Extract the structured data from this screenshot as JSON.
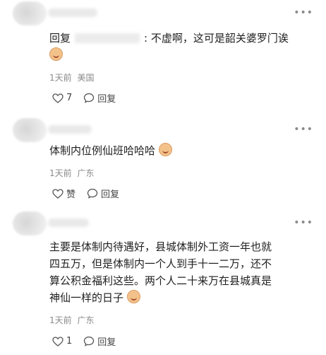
{
  "comments": [
    {
      "text_prefix": "回复",
      "text": ": 不虚啊，这可是韶关婆罗门诶",
      "time": "1天前",
      "location": "美国",
      "like_count": "7",
      "reply_label": "回复"
    },
    {
      "text": "体制内位例仙班哈哈哈",
      "time": "1天前",
      "location": "广东",
      "like_label": "赞",
      "reply_label": "回复"
    },
    {
      "text_lines": [
        "主要是体制内待遇好，县城体制外工资一年也就",
        "四五万，但是体制内一个人到手十一二万，还不",
        "算公积金福利这些。两个人二十来万在县城真是",
        "神仙一样的日子"
      ],
      "time": "1天前",
      "location": "广东",
      "like_count": "1",
      "reply_label": "回复"
    }
  ],
  "icons": {
    "more": "more-horizontal-icon",
    "like": "heart-outline-icon",
    "reply": "comment-bubble-icon",
    "emoji": "laughing-emoji-icon"
  }
}
